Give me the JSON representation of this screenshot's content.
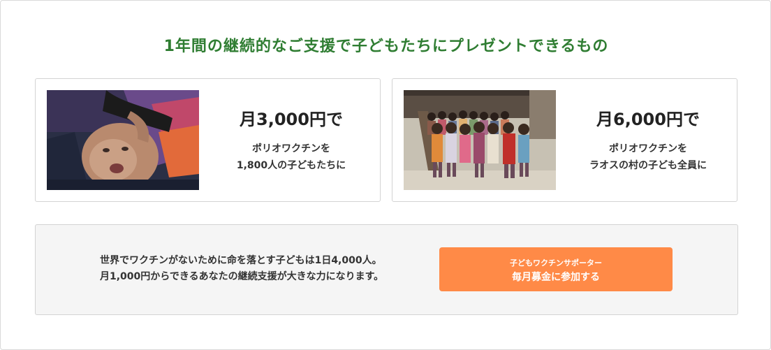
{
  "section": {
    "title": "1年間の継続的なご支援で子どもたちにプレゼントできるもの"
  },
  "cards": [
    {
      "amount": "月3,000円で",
      "desc_line1": "ポリオワクチンを",
      "desc_line2": "1,800人の子どもたちに",
      "photo": "baby-receiving-oral-vaccine-photo"
    },
    {
      "amount": "月6,000円で",
      "desc_line1": "ポリオワクチンを",
      "desc_line2": "ラオスの村の子ども全員に",
      "photo": "group-of-village-children-photo"
    }
  ],
  "banner": {
    "line1": "世界でワクチンがないために命を落とす子どもは1日4,000人。",
    "line2": "月1,000円からできるあなたの継続支援が大きな力になります。",
    "cta_sub": "子どもワクチンサポーター",
    "cta_main": "毎月募金に参加する"
  },
  "colors": {
    "title": "#2f7d32",
    "cta_background": "#ff8a47",
    "banner_background": "#f5f5f5"
  }
}
